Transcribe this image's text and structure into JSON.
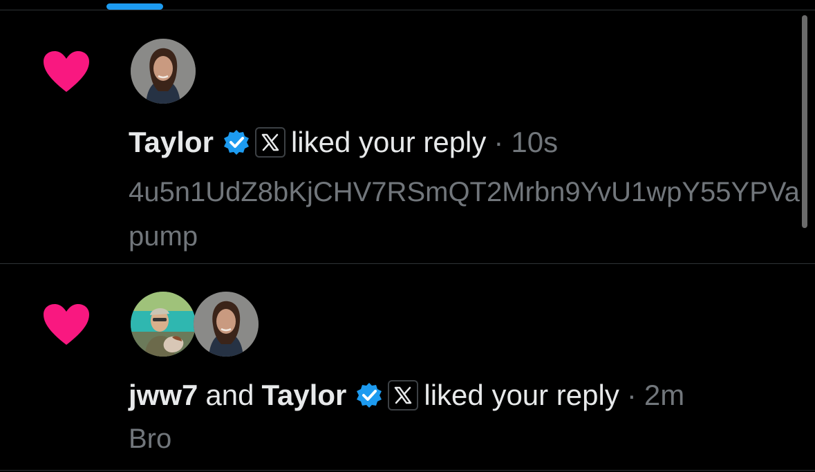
{
  "colors": {
    "background": "#000000",
    "heart": "#f91880",
    "verified": "#1d9bf0",
    "tab_indicator": "#1d9bf0",
    "divider": "#2f3336",
    "primary_text": "#e7e9ea",
    "secondary_text": "#71767b"
  },
  "notifications": [
    {
      "icon": "heart-icon",
      "users": [
        {
          "name": "Taylor",
          "verified": true,
          "avatar": "taylor-avatar"
        }
      ],
      "action": "liked your reply",
      "separator": "·",
      "time": "10s",
      "snippet": "4u5n1UdZ8bKjCHV7RSmQT2Mrbn9YvU1wpY55YPVapump"
    },
    {
      "icon": "heart-icon",
      "users": [
        {
          "name": "jww7",
          "verified": false,
          "avatar": "jww7-avatar"
        },
        {
          "name": "Taylor",
          "verified": true,
          "avatar": "taylor-avatar"
        }
      ],
      "joiner": "and",
      "action": "liked your reply",
      "separator": "·",
      "time": "2m",
      "snippet": "Bro"
    }
  ]
}
